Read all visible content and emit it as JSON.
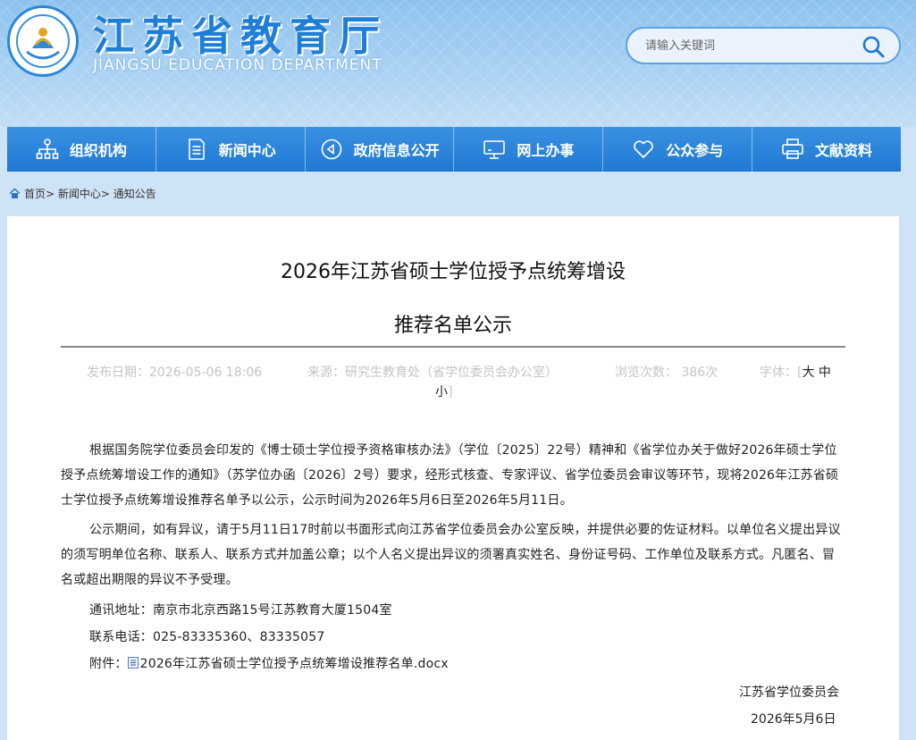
{
  "header": {
    "title": "江苏省教育厅",
    "subtitle": "JIANGSU EDUCATION DEPARTMENT",
    "search_placeholder": "请输入关键词"
  },
  "nav": [
    {
      "label": "组织机构",
      "icon": "org-chart-icon"
    },
    {
      "label": "新闻中心",
      "icon": "news-document-icon"
    },
    {
      "label": "政府信息公开",
      "icon": "government-info-icon"
    },
    {
      "label": "网上办事",
      "icon": "monitor-icon"
    },
    {
      "label": "公众参与",
      "icon": "heart-icon"
    },
    {
      "label": "文献资料",
      "icon": "printer-icon"
    }
  ],
  "breadcrumb": [
    "首页",
    "新闻中心",
    "通知公告"
  ],
  "article": {
    "title_line1": "2026年江苏省硕士学位授予点统筹增设",
    "title_line2": "推荐名单公示",
    "meta": {
      "date": "发布日期：2026-05-06 18:06",
      "source": "来源：研究生教育处（省学位委员会办公室）",
      "views": "浏览次数： 386次",
      "font_label": "字体：",
      "font_large": "大",
      "font_medium": "中",
      "font_small": "小"
    },
    "para1": "根据国务院学位委员会印发的《博士硕士学位授予资格审核办法》（学位〔2025〕22号）精神和《省学位办关于做好2026年硕士学位授予点统筹增设工作的通知》（苏学位办函〔2026〕2号）要求，经形式核查、专家评议、省学位委员会审议等环节，现将2026年江苏省硕士学位授予点统筹增设推荐名单予以公示，公示时间为2026年5月6日至2026年5月11日。",
    "para2": "公示期间，如有异议，请于5月11日17时前以书面形式向江苏省学位委员会办公室反映，并提供必要的佐证材料。以单位名义提出异议的须写明单位名称、联系人、联系方式并加盖公章；以个人名义提出异议的须署真实姓名、身份证号码、工作单位及联系方式。凡匿名、冒名或超出期限的异议不予受理。",
    "address_label": "通讯地址：",
    "address": "南京市北京西路15号江苏教育大厦1504室",
    "phone_label": "联系电话：",
    "phone": "025-83335360、83335057",
    "attachment_label": "附件：",
    "attachment": "2026年江苏省硕士学位授予点统筹增设推荐名单.docx",
    "signature": "江苏省学位委员会",
    "sign_date": "2026年5月6日"
  }
}
